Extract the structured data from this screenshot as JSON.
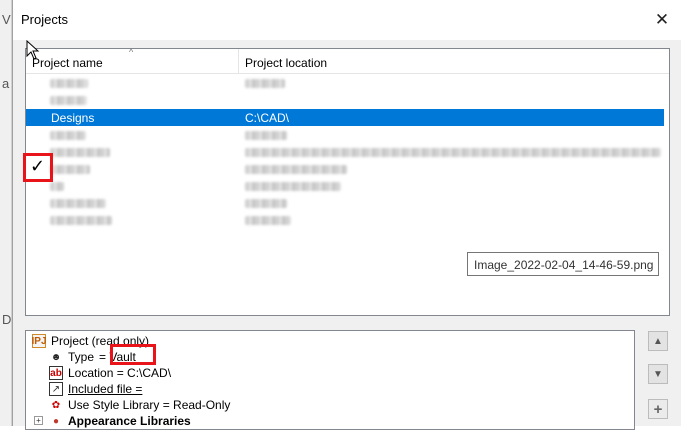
{
  "background_app": {
    "letters": [
      "V",
      "a",
      "D"
    ]
  },
  "dialog": {
    "title": "Projects",
    "close_glyph": "✕"
  },
  "list": {
    "columns": [
      "Project name",
      "Project location"
    ],
    "selected_row": {
      "check": "✓",
      "name": "Designs",
      "location": "C:\\CAD\\"
    },
    "tooltip": "Image_2022-02-04_14-46-59.png"
  },
  "tree": {
    "items": [
      {
        "icon": "project-icon",
        "icon_label": "IPJ",
        "text": "Project (read only)"
      },
      {
        "icon": "type-icon",
        "label": "Type",
        "value": "= Vault"
      },
      {
        "icon": "ab-icon",
        "icon_label": "ab",
        "text": "Location = C:\\CAD\\"
      },
      {
        "icon": "file-icon",
        "text": "Included file ="
      },
      {
        "icon": "style-icon",
        "text": "Use Style Library = Read-Only"
      },
      {
        "icon": "appearance-icon",
        "expander": "+",
        "text": "Appearance Libraries"
      }
    ]
  },
  "side_buttons": {
    "up": "▲",
    "down": "▼",
    "add": "+"
  },
  "colors": {
    "selection": "#0078d7",
    "highlight_box": "#e8141a"
  }
}
